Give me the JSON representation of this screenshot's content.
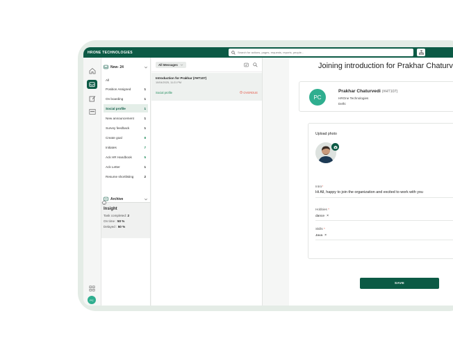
{
  "app": {
    "brand": "HRONE TECHNOLOGIES",
    "search_placeholder": "Search for actions, pages, requests, reports, people..."
  },
  "rail": {
    "user_initials": "PC"
  },
  "categories": {
    "header": "New- 24",
    "items": [
      {
        "label": "All",
        "count": ""
      },
      {
        "label": "Position Assigned",
        "count": "1"
      },
      {
        "label": "On boarding",
        "count": "1"
      },
      {
        "label": "Social profile",
        "count": "1"
      },
      {
        "label": "New announcement",
        "count": "1"
      },
      {
        "label": "Survey feedback",
        "count": "1"
      },
      {
        "label": "Create goal",
        "count": "8"
      },
      {
        "label": "Initiates",
        "count": "7"
      },
      {
        "label": "Ack HR Handbook",
        "count": "5"
      },
      {
        "label": "Ack Letter",
        "count": "1"
      },
      {
        "label": "Resume shortlisting",
        "count": "2"
      }
    ],
    "archive_label": "Archive"
  },
  "insight": {
    "title": "Insight",
    "task_label": "Task completed:",
    "task_value": "2",
    "ontime_label": "On time :",
    "ontime_value": "50 %",
    "delayed_label": "Delayed :",
    "delayed_value": "50 %"
  },
  "messages": {
    "filter_label": "All Messages",
    "items": [
      {
        "title": "Introduction for Prakhar (#HT107)",
        "date": "10/04/2025, 11:21 PM",
        "tag": "Social profile",
        "status": "OVERDUE"
      }
    ]
  },
  "detail": {
    "title": "Joining introduction for Prakhar Chaturvedi",
    "profile": {
      "initials": "PC",
      "name": "Prakhar Chaturvedi",
      "code": "(#HT107)",
      "company": "HROne Technologies",
      "location": "Delhi"
    },
    "upload_label": "Upload photo",
    "intro_label": "Intro",
    "intro_value": "Hi All, happy to join the organization and excited to work with you",
    "hobbies_label": "Hobbies",
    "hobbies": [
      "dance"
    ],
    "skills_label": "Skills",
    "skills": [
      "Java"
    ],
    "save_label": "SAVE"
  },
  "colors": {
    "primary": "#0c5a45",
    "accent": "#2fae8f",
    "overdue": "#e45b4c"
  }
}
